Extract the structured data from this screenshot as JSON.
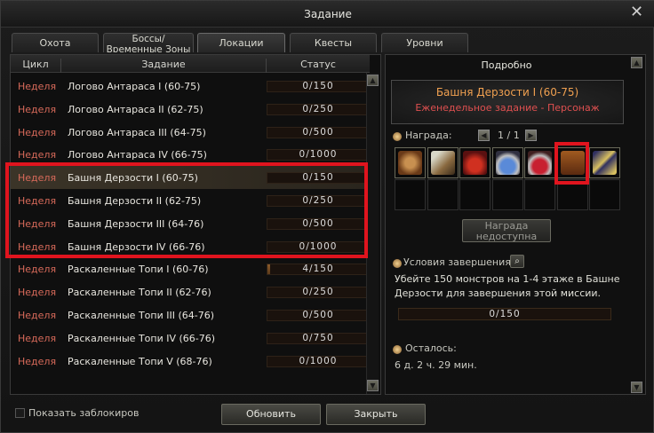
{
  "window": {
    "title": "Задание",
    "close_glyph": "✕"
  },
  "tabs": [
    {
      "label": "Охота"
    },
    {
      "label": "Боссы/ Временные Зоны"
    },
    {
      "label": "Локации"
    },
    {
      "label": "Квесты"
    },
    {
      "label": "Уровни"
    }
  ],
  "active_tab": "Локации",
  "list": {
    "headers": {
      "cycle": "Цикл",
      "quest": "Задание",
      "status": "Статус"
    },
    "rows": [
      {
        "cycle": "Неделя",
        "name": "Логово Антараса I (60-75)",
        "status": "0/150",
        "progress": 0
      },
      {
        "cycle": "Неделя",
        "name": "Логово Антараса II (62-75)",
        "status": "0/250",
        "progress": 0
      },
      {
        "cycle": "Неделя",
        "name": "Логово Антараса III (64-75)",
        "status": "0/500",
        "progress": 0
      },
      {
        "cycle": "Неделя",
        "name": "Логово Антараса IV (66-75)",
        "status": "0/1000",
        "progress": 0
      },
      {
        "cycle": "Неделя",
        "name": "Башня Дерзости I (60-75)",
        "status": "0/150",
        "progress": 0
      },
      {
        "cycle": "Неделя",
        "name": "Башня Дерзости II (62-75)",
        "status": "0/250",
        "progress": 0
      },
      {
        "cycle": "Неделя",
        "name": "Башня Дерзости III (64-76)",
        "status": "0/500",
        "progress": 0
      },
      {
        "cycle": "Неделя",
        "name": "Башня Дерзости IV (66-76)",
        "status": "0/1000",
        "progress": 0
      },
      {
        "cycle": "Неделя",
        "name": "Раскаленные Топи I (60-76)",
        "status": "4/150",
        "progress": 0.027
      },
      {
        "cycle": "Неделя",
        "name": "Раскаленные Топи II (62-76)",
        "status": "0/250",
        "progress": 0
      },
      {
        "cycle": "Неделя",
        "name": "Раскаленные Топи III (64-76)",
        "status": "0/500",
        "progress": 0
      },
      {
        "cycle": "Неделя",
        "name": "Раскаленные Топи IV (66-76)",
        "status": "0/750",
        "progress": 0
      },
      {
        "cycle": "Неделя",
        "name": "Раскаленные Топи V (68-76)",
        "status": "0/1000",
        "progress": 0
      }
    ],
    "selected_index": 4
  },
  "details": {
    "header": "Подробно",
    "quest_title": "Башня Дерзости I (60-75)",
    "quest_subtitle": "Еженедельное задание  -  Персонаж",
    "reward_label": "Награда:",
    "reward_page": "1 / 1",
    "reward_button": "Награда недоступна",
    "condition_label": "Условия завершения:",
    "condition_text": "Убейте 150 монстров на 1-4 этаже в Башне Дерзости для завершения этой миссии.",
    "condition_progress": "0/150",
    "condition_progress_value": 0,
    "remaining_label": "Осталось:",
    "remaining_value": "6 д. 2 ч. 29 мин."
  },
  "footer": {
    "show_locked": "Показать заблокиров",
    "refresh": "Обновить",
    "close": "Закрыть"
  },
  "colors": {
    "cycle_text": "#d86a5a",
    "quest_title": "#f0a050",
    "quest_subtitle": "#e05050",
    "highlight": "#e0141e"
  },
  "reward_items": [
    "compass-icon",
    "scroll-icon",
    "red-potion-icon",
    "blue-potion-icon",
    "red-flask-icon",
    "treasure-chest-icon",
    "crossed-swords-icon"
  ]
}
